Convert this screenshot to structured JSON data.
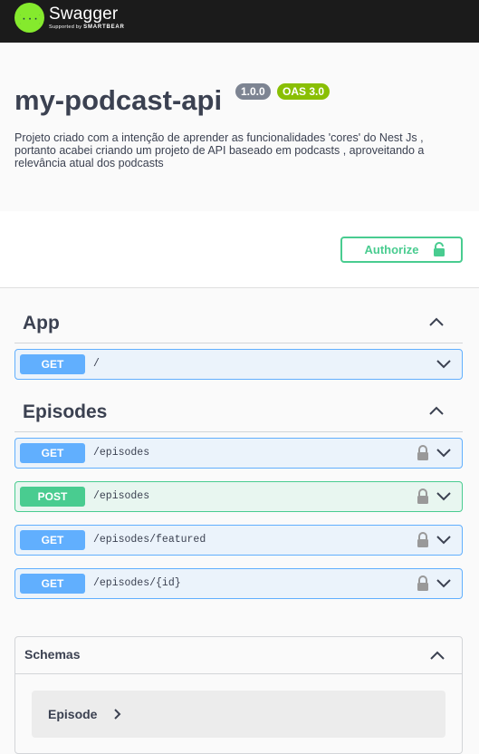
{
  "topbar": {
    "brand": "Swagger",
    "supported_prefix": "Supported by",
    "supported_brand": "SMARTBEAR",
    "logo_glyph": "{···}"
  },
  "info": {
    "title": "my-podcast-api",
    "version": "1.0.0",
    "oas": "OAS 3.0",
    "description": "Projeto criado com a intenção de aprender as funcionalidades 'cores' do Nest Js , portanto acabei criando um projeto de API baseado em podcasts , aproveitando a relevância atual dos podcasts"
  },
  "authorize": {
    "label": "Authorize",
    "icon": "unlock-icon"
  },
  "tags": [
    {
      "name": "App",
      "operations": [
        {
          "method": "GET",
          "path": "/",
          "locked": false
        }
      ]
    },
    {
      "name": "Episodes",
      "operations": [
        {
          "method": "GET",
          "path": "/episodes",
          "locked": true
        },
        {
          "method": "POST",
          "path": "/episodes",
          "locked": true
        },
        {
          "method": "GET",
          "path": "/episodes/featured",
          "locked": true
        },
        {
          "method": "GET",
          "path": "/episodes/{id}",
          "locked": true
        }
      ]
    }
  ],
  "schemas": {
    "title": "Schemas",
    "models": [
      {
        "name": "Episode"
      }
    ]
  },
  "colors": {
    "get": "#61affe",
    "post": "#49cc90",
    "swagger_green": "#85ea2d",
    "topbar": "#1b1b1b"
  }
}
